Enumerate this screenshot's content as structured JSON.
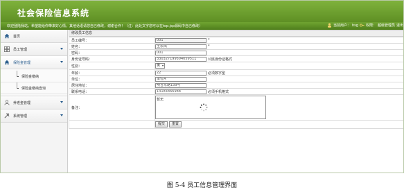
{
  "header": {
    "title": "社会保险信息系统"
  },
  "subbar": {
    "notice": "欢迎登陆我站，希望能给你带来好心情，其他话语请您自己修改，谢谢合作！（注：此处文字您可以在top.jsp源码中自己修改）",
    "current_user_label": "当前用户：",
    "current_user": "hsg",
    "role_label": "权限：",
    "role": "超级管理员",
    "logout": "退出"
  },
  "sidebar": {
    "home": "首页",
    "employee_mgmt": "员工管理",
    "insurance_mgmt": "保险金管理",
    "sub_items": [
      "保险金缴纳",
      "保险金缴纳查询"
    ],
    "pension_mgmt": "养老金管理",
    "system_mgmt": "系统管理"
  },
  "form": {
    "title": "修改员工信息",
    "labels": {
      "emp_no": "员工编号：",
      "name": "姓名：",
      "password": "密码：",
      "id_card": "身份证号码：",
      "gender": "性别：",
      "age": "年龄：",
      "unit": "单位：",
      "address": "居住地址：",
      "phone": "联系电话：",
      "remark": "备注："
    },
    "values": {
      "emp_no": "001",
      "name": "王永凤",
      "password": "001",
      "id_card": "330327199504059511",
      "gender": "男",
      "age": "22",
      "unit": "单位A",
      "address": "明言东路139号",
      "phone": "13184866988",
      "remark": "暂无"
    },
    "required_mark": "*",
    "hints": {
      "id_card": "公民身份证格式",
      "age": "必须数字型",
      "phone": "必须手机格式"
    },
    "buttons": {
      "submit": "提交",
      "reset": "重置"
    }
  },
  "caption": "图 5-4  员工信息管理界面"
}
